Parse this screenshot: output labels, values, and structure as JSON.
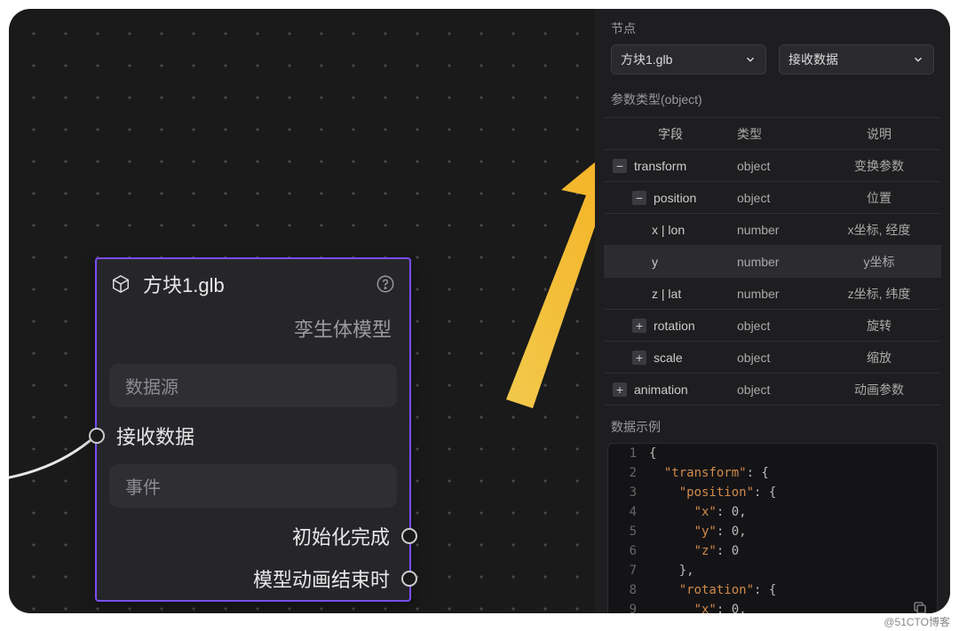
{
  "footer": "@51CTO博客",
  "node": {
    "title": "方块1.glb",
    "subtitle": "孪生体模型",
    "section_data": "数据源",
    "port_in": "接收数据",
    "section_event": "事件",
    "port_out1": "初始化完成",
    "port_out2": "模型动画结束时"
  },
  "panel": {
    "node_label": "节点",
    "select_node": "方块1.glb",
    "select_action": "接收数据",
    "param_label": "参数类型(object)",
    "columns": {
      "field": "字段",
      "type": "类型",
      "desc": "说明"
    },
    "rows": [
      {
        "expand": "−",
        "indent": 0,
        "name": "transform",
        "type": "object",
        "desc": "变换参数"
      },
      {
        "expand": "−",
        "indent": 1,
        "name": "position",
        "type": "object",
        "desc": "位置"
      },
      {
        "expand": "",
        "indent": 2,
        "name": "x | lon",
        "type": "number",
        "desc": "x坐标, 经度"
      },
      {
        "expand": "",
        "indent": 2,
        "name": "y",
        "type": "number",
        "desc": "y坐标",
        "selected": true
      },
      {
        "expand": "",
        "indent": 2,
        "name": "z | lat",
        "type": "number",
        "desc": "z坐标, 纬度"
      },
      {
        "expand": "+",
        "indent": 1,
        "name": "rotation",
        "type": "object",
        "desc": "旋转"
      },
      {
        "expand": "+",
        "indent": 1,
        "name": "scale",
        "type": "object",
        "desc": "缩放"
      },
      {
        "expand": "+",
        "indent": 0,
        "name": "animation",
        "type": "object",
        "desc": "动画参数"
      }
    ],
    "example_label": "数据示例",
    "code": [
      "{",
      "  \"transform\": {",
      "    \"position\": {",
      "      \"x\": 0,",
      "      \"y\": 0,",
      "      \"z\": 0",
      "    },",
      "    \"rotation\": {",
      "      \"x\": 0,"
    ]
  }
}
